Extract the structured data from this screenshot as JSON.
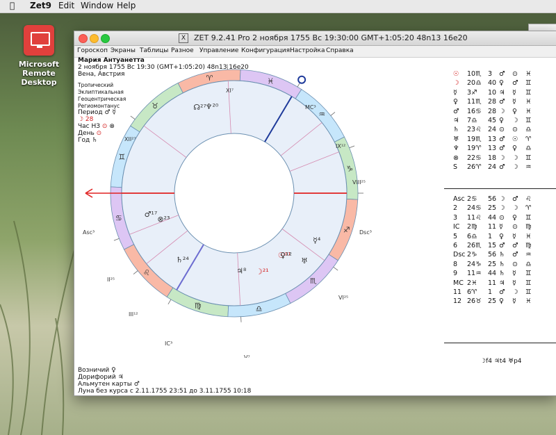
{
  "menubar": {
    "app": "Zet9",
    "items": [
      "Edit",
      "Window",
      "Help"
    ]
  },
  "desktop_icon": {
    "label_line1": "Microsoft Remote",
    "label_line2": "Desktop"
  },
  "window": {
    "title": "ZET 9.2.41 Pro    2 ноября 1755  Вс  19:30:00 GMT+1:05:20 48n13  16e20",
    "menu": [
      "Гороскоп",
      "Экраны",
      "Таблицы",
      "Разное",
      "Управление",
      "Конфигурация",
      "Настройка",
      "Справка"
    ]
  },
  "info": {
    "name": "Мария Антуанетта",
    "datetime": "2 ноября 1755  Вс  19:30 (GMT+1:05:20) 48n13  16e20",
    "place": "Вена, Австрия",
    "lines": [
      "Тропический",
      "Эклиптикальная",
      "Геоцентрическая",
      "Региомонтанус"
    ],
    "period": "Период ♂ ☿",
    "moon_day": "☽ 28",
    "hour": "Час НЗ",
    "day": "День",
    "year": "Год ♄"
  },
  "bottom": {
    "ruler": "Возничий  ♀",
    "doryphory": "Дорифорий  ♃",
    "almuten": "Альмутен карты  ♂",
    "voc": "Луна без курса с 2.11.1755 23:51 до 3.11.1755 10:18"
  },
  "planets": [
    [
      "☉",
      "10♏",
      "3",
      "♂",
      "⊙",
      "♓"
    ],
    [
      "☽",
      "20♎",
      "40",
      "♀",
      "♂",
      "♊"
    ],
    [
      "☿",
      "3♐",
      "10",
      "♃",
      "☿",
      "♊"
    ],
    [
      "♀",
      "11♏",
      "28",
      "♂",
      "☿",
      "♓"
    ],
    [
      "♂",
      "16♋",
      "28",
      "☽",
      "♀",
      "♓"
    ],
    [
      "♃",
      "7♎",
      "45",
      "♀",
      "☽",
      "♊"
    ],
    [
      "♄",
      "23♌",
      "24",
      "⊙",
      "⊙",
      "♎"
    ],
    [
      "♅",
      "19♏",
      "13",
      "♂",
      "☉",
      "♈"
    ],
    [
      "♆",
      "19♈",
      "13",
      "♂",
      "♀",
      "♎"
    ],
    [
      "⊗",
      "22♋",
      "18",
      "☽",
      "☽",
      "♊"
    ],
    [
      "S",
      "26♈",
      "24",
      "♂",
      "☽",
      "♒"
    ]
  ],
  "houses": [
    [
      "Asc",
      "2♋",
      "56",
      "☽",
      "♂",
      "♌"
    ],
    [
      "2",
      "24♋",
      "25",
      "☽",
      "☽",
      "♈"
    ],
    [
      "3",
      "11♌",
      "44",
      "⊙",
      "♀",
      "♊"
    ],
    [
      "IC",
      "2♍",
      "11",
      "☿",
      "⊙",
      "♍"
    ],
    [
      "5",
      "6♎",
      "1",
      "♀",
      "☿",
      "♓"
    ],
    [
      "6",
      "26♏",
      "15",
      "♂",
      "♂",
      "♍"
    ],
    [
      "Dsc",
      "2♑",
      "56",
      "♄",
      "♂",
      "♒"
    ],
    [
      "8",
      "24♑",
      "25",
      "♄",
      "⊙",
      "♎"
    ],
    [
      "9",
      "11♒",
      "44",
      "♄",
      "☿",
      "♊"
    ],
    [
      "MC",
      "2♓",
      "11",
      "♃",
      "☿",
      "♊"
    ],
    [
      "11",
      "6♈",
      "1",
      "♂",
      "☽",
      "♊"
    ],
    [
      "12",
      "26♉",
      "25",
      "♀",
      "☿",
      "♓"
    ]
  ],
  "aspect_line": "☽f4 ♃t4 ♅p4",
  "zodiac_signs": [
    "♈",
    "♉",
    "♊",
    "♋",
    "♌",
    "♍",
    "♎",
    "♏",
    "♐",
    "♑",
    "♒",
    "♓"
  ],
  "house_labels": {
    "asc": "Asc",
    "dsc": "Dsc",
    "mc": "MC",
    "ic": "IC",
    "II": "II",
    "III": "III",
    "V": "V",
    "VI": "VI",
    "VIII": "VIII",
    "IX": "IX",
    "XI": "XI",
    "XII": "XII"
  },
  "colors": {
    "fire": "#f9b9a6",
    "earth": "#c7e8c5",
    "air": "#c6e6fb",
    "water": "#ddc6f4",
    "inner": "#e8eff9",
    "axis": "#e02020",
    "mc": "#1e3a9a"
  }
}
